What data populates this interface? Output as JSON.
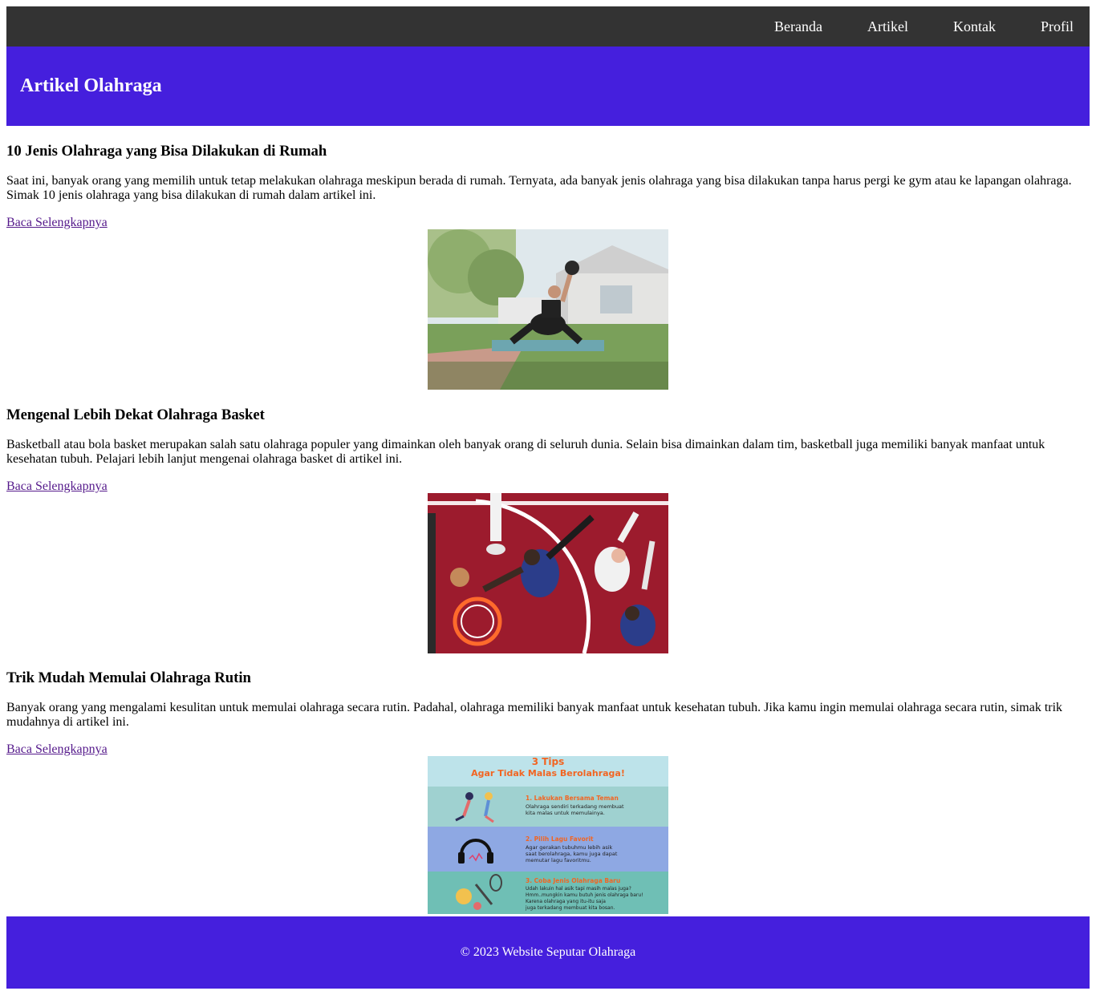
{
  "nav": {
    "items": [
      "Beranda",
      "Artikel",
      "Kontak",
      "Profil"
    ]
  },
  "header": {
    "title": "Artikel Olahraga"
  },
  "articles": [
    {
      "title": "10 Jenis Olahraga yang Bisa Dilakukan di Rumah",
      "body": "Saat ini, banyak orang yang memilih untuk tetap melakukan olahraga meskipun berada di rumah. Ternyata, ada banyak jenis olahraga yang bisa dilakukan tanpa harus pergi ke gym atau ke lapangan olahraga. Simak 10 jenis olahraga yang bisa dilakukan di rumah dalam artikel ini.",
      "link": "Baca Selengkapnya"
    },
    {
      "title": "Mengenal Lebih Dekat Olahraga Basket",
      "body": "Basketball atau bola basket merupakan salah satu olahraga populer yang dimainkan oleh banyak orang di seluruh dunia. Selain bisa dimainkan dalam tim, basketball juga memiliki banyak manfaat untuk kesehatan tubuh. Pelajari lebih lanjut mengenai olahraga basket di artikel ini.",
      "link": "Baca Selengkapnya"
    },
    {
      "title": "Trik Mudah Memulai Olahraga Rutin",
      "body": "Banyak orang yang mengalami kesulitan untuk memulai olahraga secara rutin. Padahal, olahraga memiliki banyak manfaat untuk kesehatan tubuh. Jika kamu ingin memulai olahraga secara rutin, simak trik mudahnya di artikel ini.",
      "link": "Baca Selengkapnya"
    }
  ],
  "infographic": {
    "title_line1": "3 Tips",
    "title_line2": "Agar Tidak Malas Berolahraga!",
    "tips": [
      {
        "heading": "1. Lakukan Bersama Teman",
        "text1": "Olahraga sendiri terkadang membuat",
        "text2": "kita malas untuk memulainya."
      },
      {
        "heading": "2. Pilih Lagu Favorit",
        "text1": "Agar gerakan tubuhmu lebih asik",
        "text2": "saat berolahraga, kamu juga dapat",
        "text3": "memutar lagu favoritmu."
      },
      {
        "heading": "3. Coba Jenis Olahraga Baru",
        "text1": "Udah lakuin hal asik tapi masih malas juga?",
        "text2": "Hmm..mungkin kamu butuh jenis olahraga baru!",
        "text3": "Karena olahraga yang itu-itu saja",
        "text4": "juga terkadang membuat kita bosan."
      }
    ]
  },
  "footer": {
    "text": "© 2023 Website Seputar Olahraga"
  },
  "colors": {
    "nav_bg": "#333333",
    "brand": "#451fdd",
    "link_visited": "#551a8b"
  }
}
